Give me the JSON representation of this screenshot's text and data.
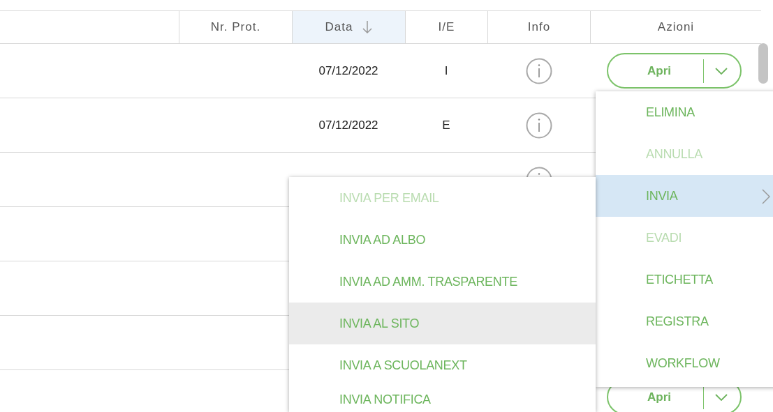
{
  "table": {
    "columns": [
      {
        "label": "Nr. Prot.",
        "sorted": false
      },
      {
        "label": "Data",
        "sorted": true
      },
      {
        "label": "I/E",
        "sorted": false
      },
      {
        "label": "Info",
        "sorted": false
      },
      {
        "label": "Azioni",
        "sorted": false
      }
    ],
    "rows": [
      {
        "date": "07/12/2022",
        "type": "I",
        "info": true,
        "action": "Apri"
      },
      {
        "date": "07/12/2022",
        "type": "E",
        "info": true
      },
      {
        "info": true
      },
      {},
      {},
      {},
      {
        "action": "Apri"
      }
    ]
  },
  "action_menu": {
    "items": [
      {
        "label": "ELIMINA",
        "disabled": false,
        "selected": false,
        "submenu": false
      },
      {
        "label": "ANNULLA",
        "disabled": true,
        "selected": false,
        "submenu": false
      },
      {
        "label": "INVIA",
        "disabled": false,
        "selected": true,
        "submenu": true
      },
      {
        "label": "EVADI",
        "disabled": true,
        "selected": false,
        "submenu": false
      },
      {
        "label": "ETICHETTA",
        "disabled": false,
        "selected": false,
        "submenu": false
      },
      {
        "label": "REGISTRA",
        "disabled": false,
        "selected": false,
        "submenu": false
      },
      {
        "label": "WORKFLOW",
        "disabled": false,
        "selected": false,
        "submenu": false
      }
    ]
  },
  "submenu": {
    "items": [
      {
        "label": "INVIA PER EMAIL",
        "disabled": true,
        "selected": false
      },
      {
        "label": "INVIA AD ALBO",
        "disabled": false,
        "selected": false
      },
      {
        "label": "INVIA AD AMM. TRASPARENTE",
        "disabled": false,
        "selected": false
      },
      {
        "label": "INVIA AL SITO",
        "disabled": false,
        "selected": true
      },
      {
        "label": "INVIA A SCUOLANEXT",
        "disabled": false,
        "selected": false
      },
      {
        "label": "INVIA NOTIFICA",
        "disabled": false,
        "selected": false
      }
    ]
  }
}
